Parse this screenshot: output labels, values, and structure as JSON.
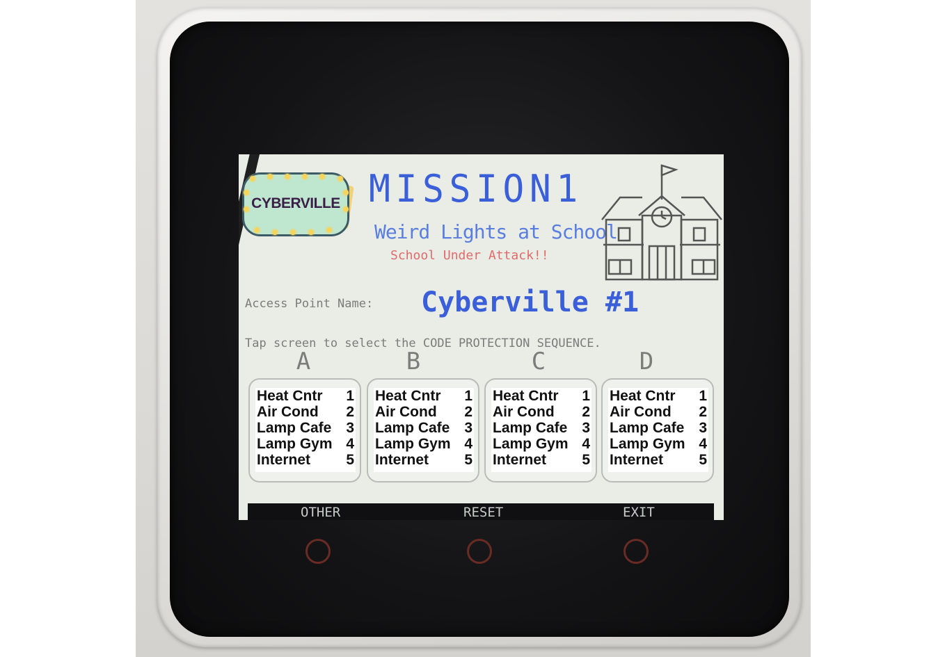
{
  "sign": {
    "text": "CYBERVILLE"
  },
  "header": {
    "title": "MISSION1",
    "subtitle": "Weird Lights at School",
    "alert": "School Under Attack!!"
  },
  "access_point": {
    "label": "Access Point Name:",
    "value": "Cyberville #1"
  },
  "instruction": "Tap screen to select the CODE PROTECTION SEQUENCE.",
  "options": [
    {
      "letter": "A",
      "items": [
        {
          "name": "Heat Cntr",
          "num": "1"
        },
        {
          "name": "Air Cond",
          "num": "2"
        },
        {
          "name": "Lamp Cafe",
          "num": "3"
        },
        {
          "name": "Lamp Gym",
          "num": "4"
        },
        {
          "name": "Internet",
          "num": "5"
        }
      ]
    },
    {
      "letter": "B",
      "items": [
        {
          "name": "Heat Cntr",
          "num": "1"
        },
        {
          "name": "Air Cond",
          "num": "2"
        },
        {
          "name": "Lamp Cafe",
          "num": "3"
        },
        {
          "name": "Lamp Gym",
          "num": "4"
        },
        {
          "name": "Internet",
          "num": "5"
        }
      ]
    },
    {
      "letter": "C",
      "items": [
        {
          "name": "Heat Cntr",
          "num": "1"
        },
        {
          "name": "Air Cond",
          "num": "2"
        },
        {
          "name": "Lamp Cafe",
          "num": "3"
        },
        {
          "name": "Lamp Gym",
          "num": "4"
        },
        {
          "name": "Internet",
          "num": "5"
        }
      ]
    },
    {
      "letter": "D",
      "items": [
        {
          "name": "Heat Cntr",
          "num": "1"
        },
        {
          "name": "Air Cond",
          "num": "2"
        },
        {
          "name": "Lamp Cafe",
          "num": "3"
        },
        {
          "name": "Lamp Gym",
          "num": "4"
        },
        {
          "name": "Internet",
          "num": "5"
        }
      ]
    }
  ],
  "footer": {
    "other": "OTHER",
    "reset": "RESET",
    "exit": "EXIT"
  },
  "icons": {
    "school": "school-building-icon",
    "sign": "cyberville-sign-icon"
  },
  "colors": {
    "accent": "#3a5fd8",
    "alert": "#e06a6a",
    "screen_bg": "#e9ede6"
  }
}
